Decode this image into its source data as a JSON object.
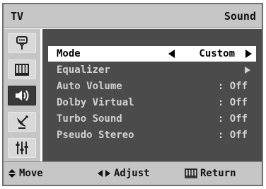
{
  "header": {
    "tv_label": "TV",
    "title": "Sound"
  },
  "sidebar": {
    "items": [
      {
        "icon": "antenna-plug-icon",
        "active": false
      },
      {
        "icon": "picture-grid-icon",
        "active": false
      },
      {
        "icon": "speaker-icon",
        "active": true
      },
      {
        "icon": "satellite-dish-icon",
        "active": false
      },
      {
        "icon": "setup-sliders-icon",
        "active": false
      }
    ]
  },
  "menu": {
    "rows": [
      {
        "label": "Mode",
        "value": "Custom",
        "selected": true
      },
      {
        "label": "Equalizer",
        "value": "",
        "selected": false
      },
      {
        "label": "Auto Volume",
        "value": ": Off",
        "selected": false
      },
      {
        "label": "Dolby Virtual",
        "value": ": Off",
        "selected": false
      },
      {
        "label": "Turbo Sound",
        "value": ": Off",
        "selected": false
      },
      {
        "label": "Pseudo Stereo",
        "value": ": Off",
        "selected": false
      }
    ]
  },
  "footer": {
    "move": "Move",
    "adjust": "Adjust",
    "return": "Return"
  },
  "colors": {
    "panel": "#4b4b4b",
    "chrome": "#c6c6c6",
    "active_icon": "#3a3a3a",
    "highlight": "#ffffff"
  }
}
